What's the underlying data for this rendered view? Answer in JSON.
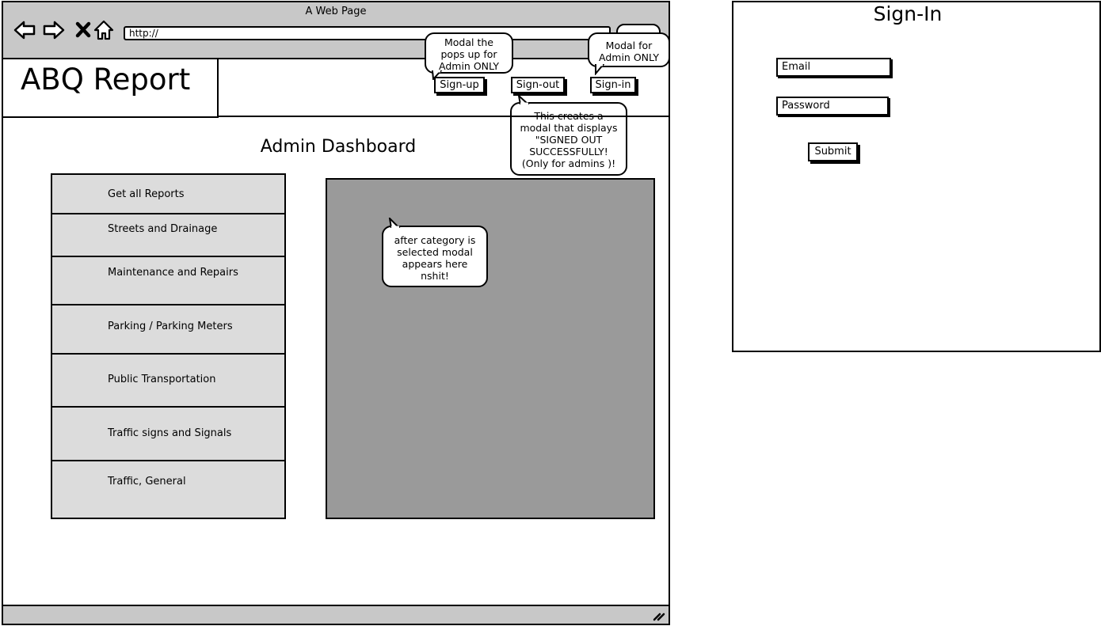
{
  "window": {
    "title": "A Web Page",
    "url": "http://"
  },
  "header": {
    "logo": "ABQ Report",
    "buttons": {
      "signup": "Sign-up",
      "signout": "Sign-out",
      "signin": "Sign-in"
    }
  },
  "annotations": {
    "signup_note": [
      "Modal the",
      "pops up for",
      "Admin ONLY"
    ],
    "signin_note": [
      "Modal for",
      "Admin ONLY"
    ],
    "signout_note": [
      "This creates a",
      "modal that displays",
      "\"SIGNED OUT",
      "SUCCESSFULLY!",
      "(Only for admins )!"
    ],
    "content_note": [
      "after category is",
      "selected modal",
      "appears here",
      "nshit!"
    ]
  },
  "main": {
    "title": "Admin Dashboard",
    "categories": [
      "Get all Reports",
      "Streets and Drainage",
      "Maintenance and Repairs",
      "Parking / Parking Meters",
      "Public Transportation",
      "Traffic signs and Signals",
      "Traffic, General"
    ]
  },
  "signin": {
    "title": "Sign-In",
    "email_placeholder": "Email",
    "password_placeholder": "Password",
    "submit_label": "Submit"
  },
  "icons": [
    "back-icon",
    "forward-icon",
    "close-icon",
    "home-icon",
    "resize-icon"
  ],
  "colors": {
    "chrome": "#c8c8c8",
    "panel": "#9a9a9a",
    "list": "#dcdcdc"
  }
}
